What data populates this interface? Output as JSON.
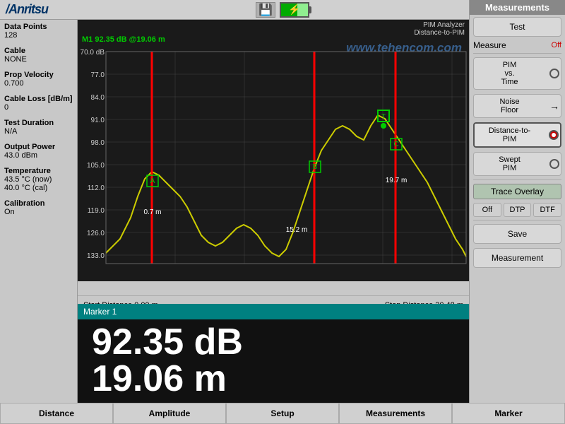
{
  "header": {
    "logo": "/Anritsu",
    "save_icon": "💾"
  },
  "left_panel": {
    "items": [
      {
        "label": "Data Points",
        "value": "128"
      },
      {
        "label": "Cable",
        "value": "NONE"
      },
      {
        "label": "Prop Velocity",
        "value": "0.700"
      },
      {
        "label": "Cable Loss [dB/m]",
        "value": "0"
      },
      {
        "label": "Test Duration",
        "value": "N/A"
      },
      {
        "label": "Output Power",
        "value": "43.0 dBm"
      },
      {
        "label": "Temperature",
        "value": "43.5 °C (now)\n40.0 °C (cal)"
      },
      {
        "label": "Calibration",
        "value": "On"
      }
    ]
  },
  "chart": {
    "pim_analyzer": "PIM Analyzer",
    "distance_to_pim": "Distance-to-PIM",
    "marker_text": "M1 92.35 dB @19.06 m",
    "watermark": "www.tehencom.com",
    "y_labels": [
      "70.0 dB",
      "77.0",
      "84.0",
      "91.0",
      "98.0",
      "105.0",
      "112.0",
      "119.0",
      "126.0",
      "133.0"
    ],
    "start_distance": "Start Distance 0.00 m",
    "stop_distance": "Stop Distance 30.48 m",
    "marker_a": "A",
    "marker_b": "B",
    "marker_c": "C",
    "marker_t": "T",
    "dist_07": "0.7 m",
    "dist_152": "15.2 m",
    "dist_197": "19.7 m"
  },
  "marker_info": {
    "title": "Marker 1",
    "db_value": "92.35 dB",
    "m_value": "19.06 m"
  },
  "right_panel": {
    "title": "Measurements",
    "test_label": "Test",
    "measure_label": "Measure",
    "measure_value": "Off",
    "pim_vs_time": "PIM\nvs.\nTime",
    "noise_floor": "Noise\nFloor",
    "arrow": "→",
    "distance_to_pim": "Distance-to-\nPIM",
    "swept_pim": "Swept\nPIM",
    "trace_overlay": "Trace Overlay",
    "off_label": "Off",
    "dtp_label": "DTP",
    "dtf_label": "DTF",
    "save_label": "Save",
    "measurement_label": "Measurement"
  },
  "bottom_tabs": [
    "Distance",
    "Amplitude",
    "Setup",
    "Measurements",
    "Marker"
  ]
}
